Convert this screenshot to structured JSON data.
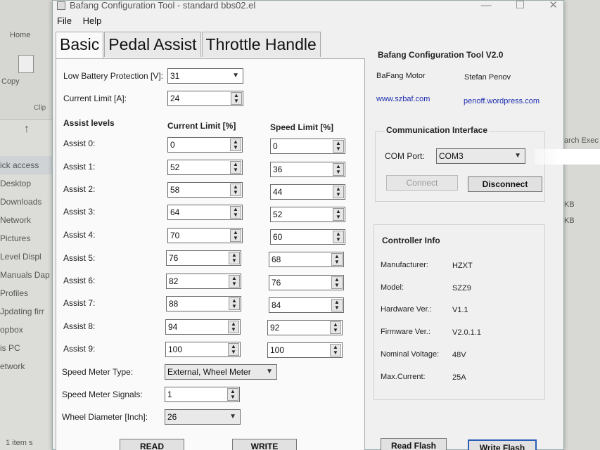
{
  "background": {
    "ribbon_home": "Home",
    "ribbon_copy": "Copy",
    "ribbon_clip": "Clip",
    "nav_items": [
      "ick access",
      "Desktop",
      "Downloads",
      "Network",
      "Pictures",
      "Level Displ",
      "Manuals Dap",
      "Profiles",
      "Jpdating firr",
      "opbox",
      "is PC",
      "etwork"
    ],
    "right_text_1": "arch Exec",
    "right_kb_1": "KB",
    "right_kb_2": "KB",
    "status": "1 item s"
  },
  "window": {
    "title": "Bafang Configuration Tool - standard bbs02.el",
    "min": "—",
    "max": "☐",
    "close": "✕"
  },
  "menu": {
    "file": "File",
    "help": "Help"
  },
  "tabs": [
    "Basic",
    "Pedal Assist",
    "Throttle Handle"
  ],
  "basic": {
    "low_battery_label": "Low Battery Protection [V]:",
    "low_battery_value": "31",
    "current_limit_label": "Current Limit [A]:",
    "current_limit_value": "24",
    "assist_levels_header": "Assist levels",
    "current_limit_header": "Current Limit [%]",
    "speed_limit_header": "Speed Limit [%]",
    "assist": [
      {
        "label": "Assist 0:",
        "current": "0",
        "speed": "0"
      },
      {
        "label": "Assist 1:",
        "current": "52",
        "speed": "36"
      },
      {
        "label": "Assist 2:",
        "current": "58",
        "speed": "44"
      },
      {
        "label": "Assist 3:",
        "current": "64",
        "speed": "52"
      },
      {
        "label": "Assist 4:",
        "current": "70",
        "speed": "60"
      },
      {
        "label": "Assist 5:",
        "current": "76",
        "speed": "68"
      },
      {
        "label": "Assist 6:",
        "current": "82",
        "speed": "76"
      },
      {
        "label": "Assist 7:",
        "current": "88",
        "speed": "84"
      },
      {
        "label": "Assist 8:",
        "current": "94",
        "speed": "92"
      },
      {
        "label": "Assist 9:",
        "current": "100",
        "speed": "100"
      }
    ],
    "speed_meter_type_label": "Speed Meter Type:",
    "speed_meter_type_value": "External, Wheel Meter",
    "speed_meter_signals_label": "Speed Meter Signals:",
    "speed_meter_signals_value": "1",
    "wheel_diameter_label": "Wheel Diameter [Inch]:",
    "wheel_diameter_value": "26",
    "read_button": "READ",
    "write_button": "WRITE"
  },
  "about": {
    "title": "Bafang Configuration Tool V2.0",
    "company": "BaFang Motor",
    "author": "Stefan Penov",
    "link1": "www.szbaf.com",
    "link2": "penoff.wordpress.com"
  },
  "comm": {
    "title": "Communication Interface",
    "port_label": "COM Port:",
    "port_value": "COM3",
    "connect": "Connect",
    "disconnect": "Disconnect"
  },
  "controller": {
    "title": "Controller Info",
    "rows": [
      {
        "label": "Manufacturer:",
        "value": "HZXT"
      },
      {
        "label": "Model:",
        "value": "SZZ9"
      },
      {
        "label": "Hardware Ver.:",
        "value": "V1.1"
      },
      {
        "label": "Firmware Ver.:",
        "value": "V2.0.1.1"
      },
      {
        "label": "Nominal Voltage:",
        "value": "48V"
      },
      {
        "label": "Max.Current:",
        "value": "25A"
      }
    ],
    "read_flash": "Read Flash",
    "write_flash": "Write Flash"
  }
}
